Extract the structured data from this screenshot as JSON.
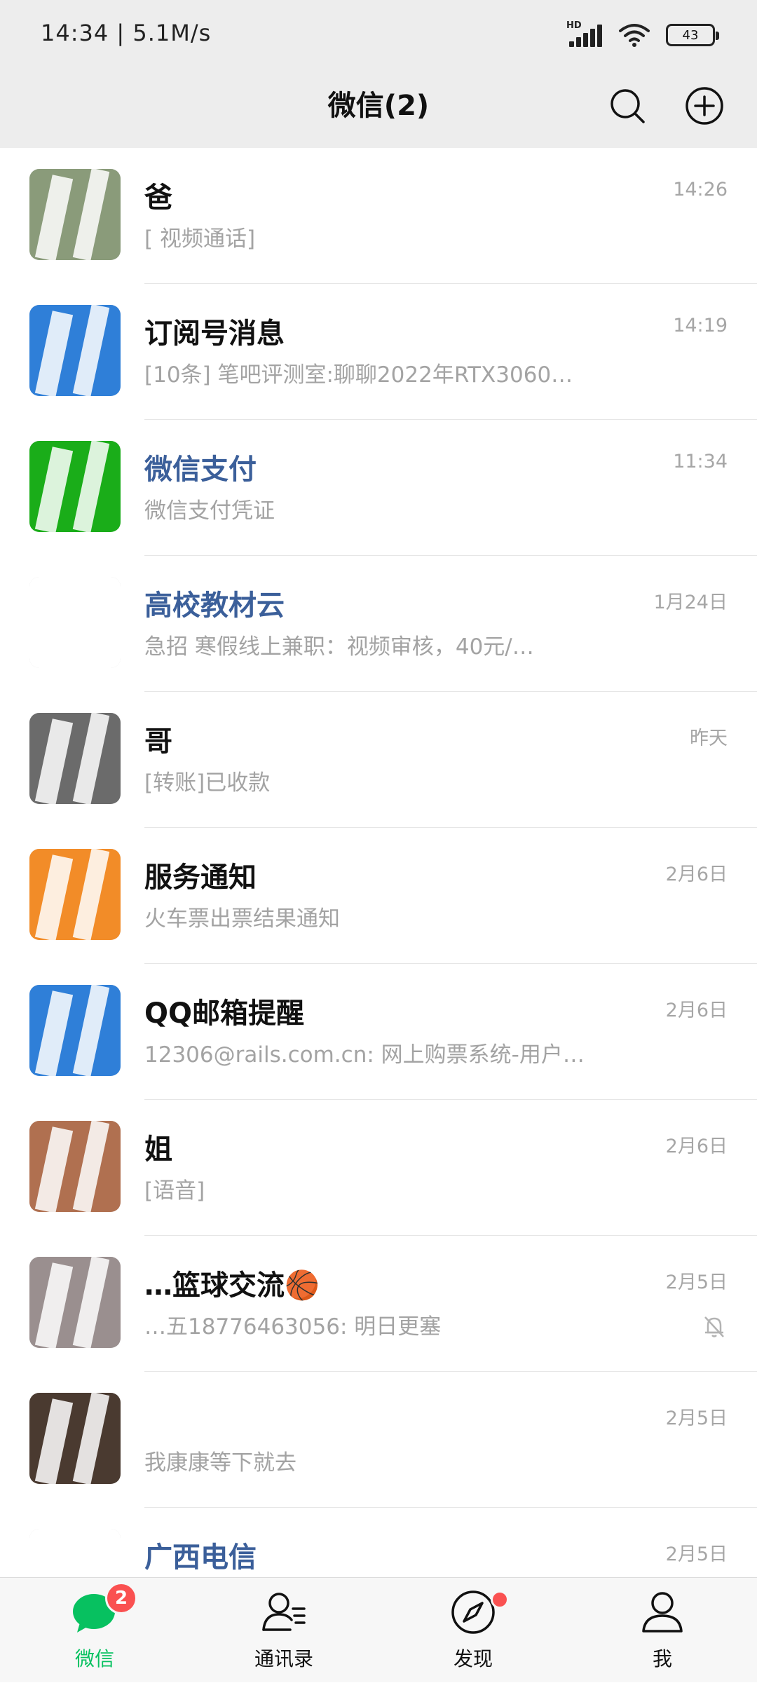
{
  "status_bar": {
    "time_speed": "14:34 | 5.1M/s",
    "network_label": "HD",
    "battery": "43",
    "icons": [
      "signal-icon",
      "wifi-icon",
      "battery-icon"
    ]
  },
  "header": {
    "title": "微信(2)",
    "icons": [
      "search-icon",
      "plus-circle-icon"
    ]
  },
  "chats": [
    {
      "name": "爸",
      "preview": "[ 视频通话]",
      "time": "14:26",
      "muted": false,
      "name_color": "#111111",
      "avatar_color": "#8a9b7a"
    },
    {
      "name": "订阅号消息",
      "preview": "[10条] 笔吧评测室:聊聊2022年RTX3060…",
      "time": "14:19",
      "muted": false,
      "name_color": "#111111",
      "avatar_color": "#2f7fd8"
    },
    {
      "name": "微信支付",
      "preview": "微信支付凭证",
      "time": "11:34",
      "muted": false,
      "name_color": "#3b5f9a",
      "avatar_color": "#1aad19"
    },
    {
      "name": "高校教材云",
      "preview": "急招 寒假线上兼职：视频审核，40元/…",
      "time": "1月24日",
      "muted": false,
      "name_color": "#3b5f9a",
      "avatar_color": "#ffffff"
    },
    {
      "name": "哥",
      "preview": "[转账]已收款",
      "time": "昨天",
      "muted": false,
      "name_color": "#111111",
      "avatar_color": "#6b6b6b"
    },
    {
      "name": "服务通知",
      "preview": "火车票出票结果通知",
      "time": "2月6日",
      "muted": false,
      "name_color": "#111111",
      "avatar_color": "#f28c28"
    },
    {
      "name": "QQ邮箱提醒",
      "preview": "12306@rails.com.cn: 网上购票系统-用户…",
      "time": "2月6日",
      "muted": false,
      "name_color": "#111111",
      "avatar_color": "#2f7fd8"
    },
    {
      "name": "姐",
      "preview": "[语音]",
      "time": "2月6日",
      "muted": false,
      "name_color": "#111111",
      "avatar_color": "#b07050"
    },
    {
      "name": "…篮球交流🏀",
      "preview": "…五18776463056: 明日更塞",
      "time": "2月5日",
      "muted": true,
      "name_color": "#111111",
      "avatar_color": "#9a8f8f"
    },
    {
      "name": "",
      "preview": "我康康等下就去",
      "time": "2月5日",
      "muted": false,
      "name_color": "#111111",
      "avatar_color": "#4a3a30"
    },
    {
      "name": "广西电信",
      "preview": "",
      "time": "2月5日",
      "muted": false,
      "name_color": "#3b5f9a",
      "avatar_color": "#ffffff"
    }
  ],
  "tabbar": {
    "tabs": [
      {
        "label": "微信",
        "icon": "chat-bubble-icon",
        "badge": "2",
        "active": true
      },
      {
        "label": "通讯录",
        "icon": "contacts-icon",
        "badge": "",
        "active": false
      },
      {
        "label": "发现",
        "icon": "compass-icon",
        "badge": "dot",
        "active": false
      },
      {
        "label": "我",
        "icon": "person-icon",
        "badge": "",
        "active": false
      }
    ]
  },
  "colors": {
    "accent": "#07c160",
    "badge": "#fa5151",
    "header_bg": "#ededed"
  }
}
